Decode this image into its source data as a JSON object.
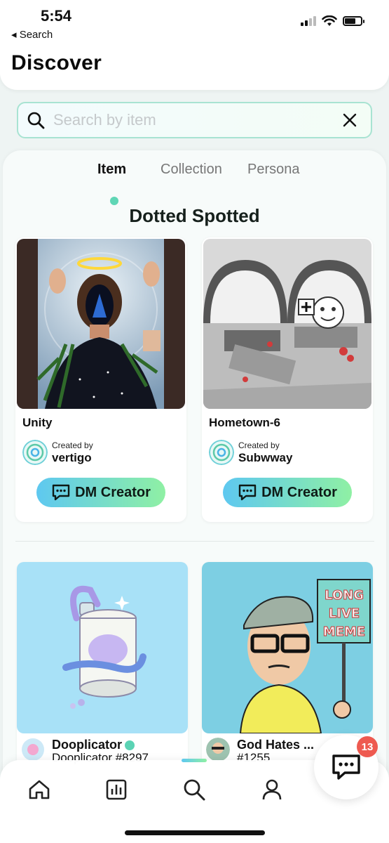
{
  "status_bar": {
    "time": "5:54",
    "back_label": "◂ Search"
  },
  "header": {
    "title": "Discover"
  },
  "search": {
    "placeholder": "Search by item",
    "value": ""
  },
  "tabs": [
    {
      "label": "Item",
      "active": true
    },
    {
      "label": "Collection",
      "active": false
    },
    {
      "label": "Persona",
      "active": false
    }
  ],
  "section": {
    "title": "Dotted Spotted"
  },
  "spotted_cards": [
    {
      "name": "Unity",
      "created_by_label": "Created by",
      "creator": "vertigo",
      "button_label": "DM Creator"
    },
    {
      "name": "Hometown-6",
      "created_by_label": "Created by",
      "creator": "Subwway",
      "button_label": "DM Creator"
    }
  ],
  "feed_cards": [
    {
      "title": "Dooplicator",
      "subtitle": "Dooplicator #8297",
      "verified": true
    },
    {
      "title": "God Hates ...",
      "subtitle": "#1255",
      "verified": false
    }
  ],
  "fab": {
    "badge_count": "13"
  },
  "colors": {
    "accent_start": "#5ec8f0",
    "accent_end": "#8ff0a4",
    "badge": "#ee5a50",
    "tab_dot": "#5fd6b5"
  },
  "icons": [
    "search-icon",
    "close-icon",
    "chat-icon",
    "home-icon",
    "stats-icon",
    "profile-icon"
  ]
}
